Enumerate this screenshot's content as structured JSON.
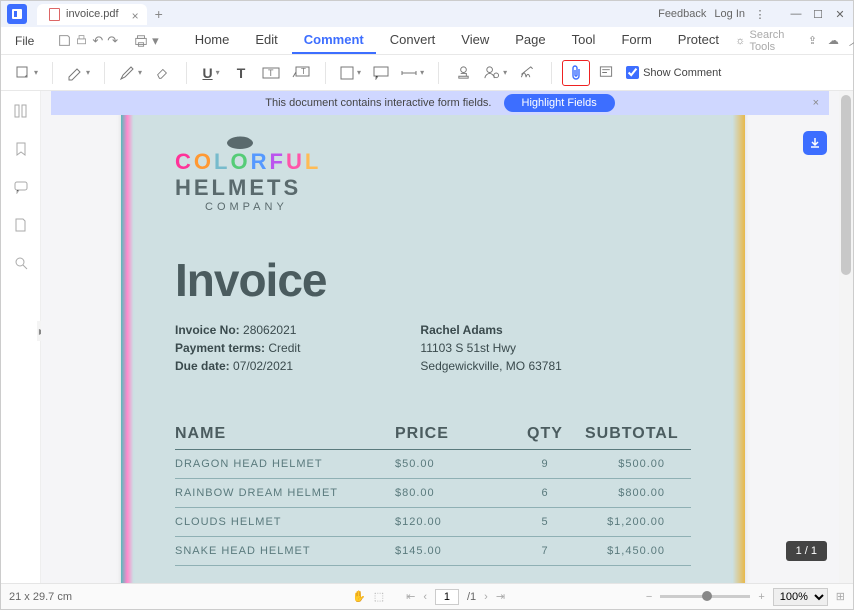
{
  "titlebar": {
    "tab_name": "invoice.pdf",
    "feedback": "Feedback",
    "login": "Log In"
  },
  "menubar": {
    "file": "File",
    "items": [
      "Home",
      "Edit",
      "Comment",
      "Convert",
      "View",
      "Page",
      "Tool",
      "Form",
      "Protect"
    ],
    "active_index": 2,
    "search_placeholder": "Search Tools"
  },
  "toolbar": {
    "show_comment": "Show Comment"
  },
  "banner": {
    "message": "This document contains interactive form fields.",
    "button": "Highlight Fields"
  },
  "doc": {
    "logo_line1": "COLORFUL",
    "logo_line2": "HELMETS",
    "logo_line3": "COMPANY",
    "title": "Invoice",
    "meta": {
      "invoice_no_label": "Invoice No:",
      "invoice_no": "28062021",
      "payment_terms_label": "Payment terms:",
      "payment_terms": "Credit",
      "due_date_label": "Due date:",
      "due_date": "07/02/2021",
      "bill_name": "Rachel Adams",
      "bill_addr1": "11103 S 51st Hwy",
      "bill_addr2": "Sedgewickville, MO 63781"
    },
    "table": {
      "headers": [
        "NAME",
        "PRICE",
        "QTY",
        "SUBTOTAL"
      ],
      "rows": [
        [
          "DRAGON HEAD HELMET",
          "$50.00",
          "9",
          "$500.00"
        ],
        [
          "RAINBOW DREAM HELMET",
          "$80.00",
          "6",
          "$800.00"
        ],
        [
          "CLOUDS HELMET",
          "$120.00",
          "5",
          "$1,200.00"
        ],
        [
          "SNAKE HEAD HELMET",
          "$145.00",
          "7",
          "$1,450.00"
        ]
      ]
    }
  },
  "page_badge": "1 / 1",
  "statusbar": {
    "dims": "21 x 29.7 cm",
    "page_current": "1",
    "page_total": "/1",
    "zoom": "100%"
  }
}
